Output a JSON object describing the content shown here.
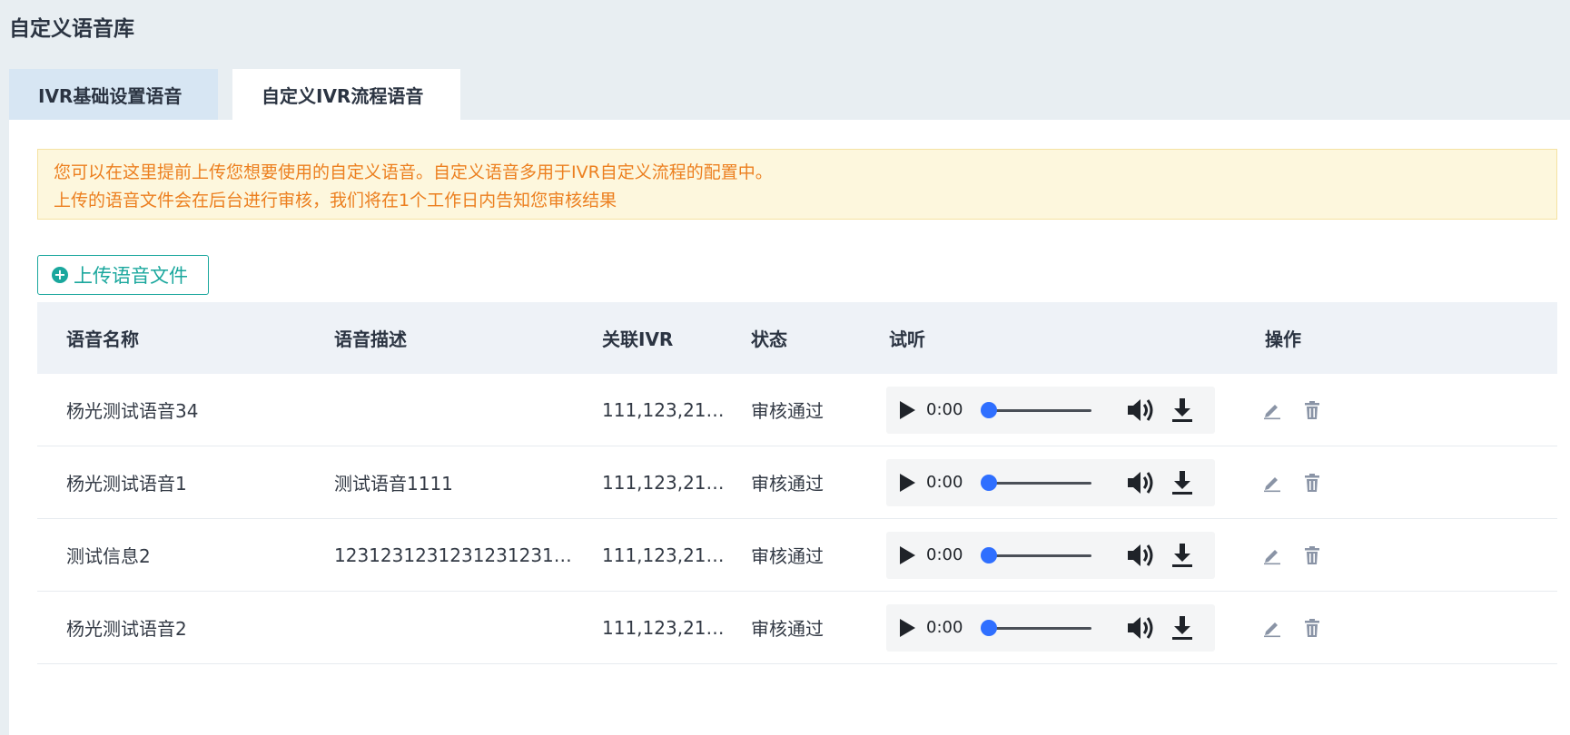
{
  "page": {
    "title": "自定义语音库"
  },
  "tabs": [
    {
      "label": "IVR基础设置语音",
      "active": false
    },
    {
      "label": "自定义IVR流程语音",
      "active": true
    }
  ],
  "notice": {
    "line1": "您可以在这里提前上传您想要使用的自定义语音。自定义语音多用于IVR自定义流程的配置中。",
    "line2": "上传的语音文件会在后台进行审核，我们将在1个工作日内告知您审核结果"
  },
  "upload_button": {
    "label": "上传语音文件",
    "icon": "plus-circle-icon"
  },
  "table": {
    "headers": {
      "name": "语音名称",
      "desc": "语音描述",
      "ivr": "关联IVR",
      "status": "状态",
      "listen": "试听",
      "ops": "操作"
    },
    "rows": [
      {
        "name": "杨光测试语音34",
        "desc": "",
        "ivr": "111,123,2131...",
        "status": "审核通过",
        "time": "0:00"
      },
      {
        "name": "杨光测试语音1",
        "desc": "测试语音1111",
        "ivr": "111,123,2131...",
        "status": "审核通过",
        "time": "0:00"
      },
      {
        "name": "测试信息2",
        "desc": "12312312312312312312...",
        "ivr": "111,123,2131...",
        "status": "审核通过",
        "time": "0:00"
      },
      {
        "name": "杨光测试语音2",
        "desc": "",
        "ivr": "111,123,2131...",
        "status": "审核通过",
        "time": "0:00"
      }
    ]
  },
  "colors": {
    "accent": "#1aa79d",
    "notice_text": "#ec7f1f",
    "notice_bg": "#fdf7dd",
    "player_thumb": "#2f6fff"
  },
  "icons": {
    "play": "play-icon",
    "volume": "volume-icon",
    "download": "download-icon",
    "edit": "edit-icon",
    "delete": "trash-icon"
  }
}
